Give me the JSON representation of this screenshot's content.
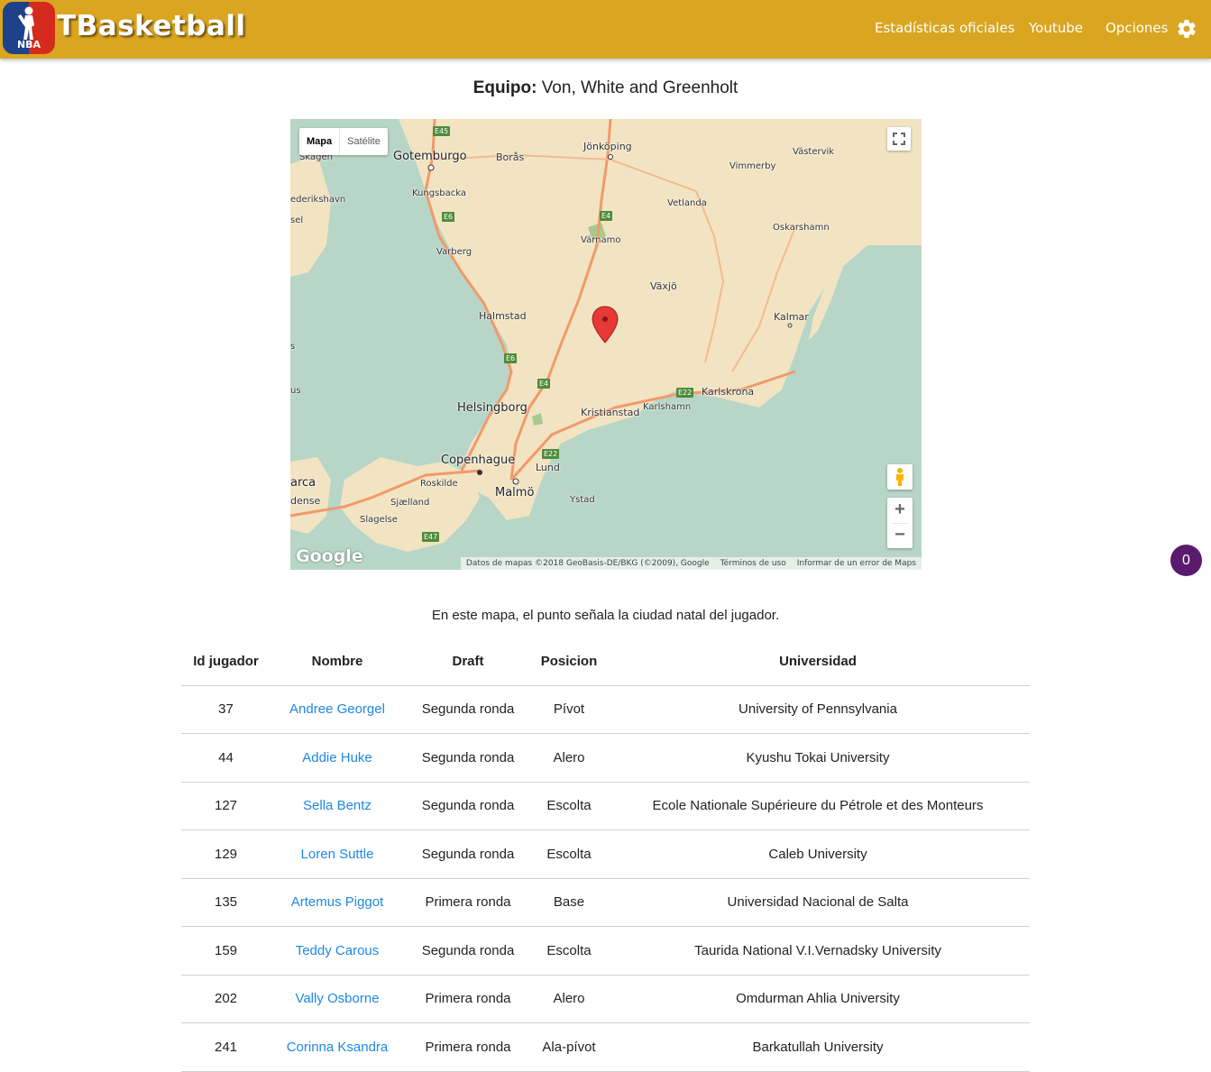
{
  "header": {
    "logo_text": "NBA",
    "brand": "TBasketball",
    "nav": [
      "Estadísticas oficiales",
      "Youtube",
      "Opciones"
    ],
    "settings_icon": "gear-icon",
    "bar_color": "#daa520"
  },
  "page": {
    "heading_label": "Equipo:",
    "team_name": "Von, White and Greenholt",
    "caption": "En este mapa, el punto señala la ciudad natal del jugador.",
    "counter": "0"
  },
  "map": {
    "type_options": [
      "Mapa",
      "Satélite"
    ],
    "selected_type": "Mapa",
    "google_logo": "Google",
    "attribution": "Datos de mapas ©2018 GeoBasis-DE/BKG (©2009), Google",
    "terms": "Términos de uso",
    "report": "Informar de un error de Maps",
    "zoom_in": "+",
    "zoom_out": "−",
    "marker_icon": "map-pin-icon",
    "cities": {
      "goteborg": "Gotemburgo",
      "boras": "Borås",
      "jonkoping": "Jönköping",
      "vastervik": "Västervik",
      "vimmerby": "Vimmerby",
      "skagen": "Skagen",
      "frederikshavn": "ederikshavn",
      "kungsbacka": "Kungsbacka",
      "vetlanda": "Vetlanda",
      "sel": "sel",
      "oskarshamn": "Oskarshamn",
      "varberg": "Varberg",
      "varnamo": "Värnamo",
      "vaxjo": "Växjö",
      "halmstad": "Halmstad",
      "kalmar": "Kalmar",
      "s": "s",
      "karlskrona": "Karlskrona",
      "us": "us",
      "helsingborg": "Helsingborg",
      "karlshamn": "Karlshamn",
      "kristianstad": "Kristianstad",
      "copenhague": "Copenhague",
      "lund": "Lund",
      "arca": "arca",
      "roskilde": "Roskilde",
      "malmo": "Malmö",
      "dense": "dense",
      "sjaelland": "Sjælland",
      "ystad": "Ystad",
      "slagelse": "Slagelse"
    },
    "roads": {
      "e45": "E45",
      "e6a": "E6",
      "e4a": "E4",
      "e6b": "E6",
      "e4b": "E4",
      "e22a": "E22",
      "e22b": "E22",
      "e47": "E47"
    }
  },
  "table": {
    "columns": [
      "Id jugador",
      "Nombre",
      "Draft",
      "Posicion",
      "Universidad"
    ],
    "rows": [
      {
        "id": "37",
        "name": "Andree Georgel",
        "draft": "Segunda ronda",
        "position": "Pívot",
        "university": "University of Pennsylvania"
      },
      {
        "id": "44",
        "name": "Addie Huke",
        "draft": "Segunda ronda",
        "position": "Alero",
        "university": "Kyushu Tokai University"
      },
      {
        "id": "127",
        "name": "Sella Bentz",
        "draft": "Segunda ronda",
        "position": "Escolta",
        "university": "Ecole Nationale Supérieure du Pétrole et des Monteurs"
      },
      {
        "id": "129",
        "name": "Loren Suttle",
        "draft": "Segunda ronda",
        "position": "Escolta",
        "university": "Caleb University"
      },
      {
        "id": "135",
        "name": "Artemus Piggot",
        "draft": "Primera ronda",
        "position": "Base",
        "university": "Universidad Nacional de Salta"
      },
      {
        "id": "159",
        "name": "Teddy Carous",
        "draft": "Segunda ronda",
        "position": "Escolta",
        "university": "Taurida National V.I.Vernadsky University"
      },
      {
        "id": "202",
        "name": "Vally Osborne",
        "draft": "Primera ronda",
        "position": "Alero",
        "university": "Omdurman Ahlia University"
      },
      {
        "id": "241",
        "name": "Corinna Ksandra",
        "draft": "Primera ronda",
        "position": "Ala-pívot",
        "university": "Barkatullah University"
      }
    ]
  }
}
